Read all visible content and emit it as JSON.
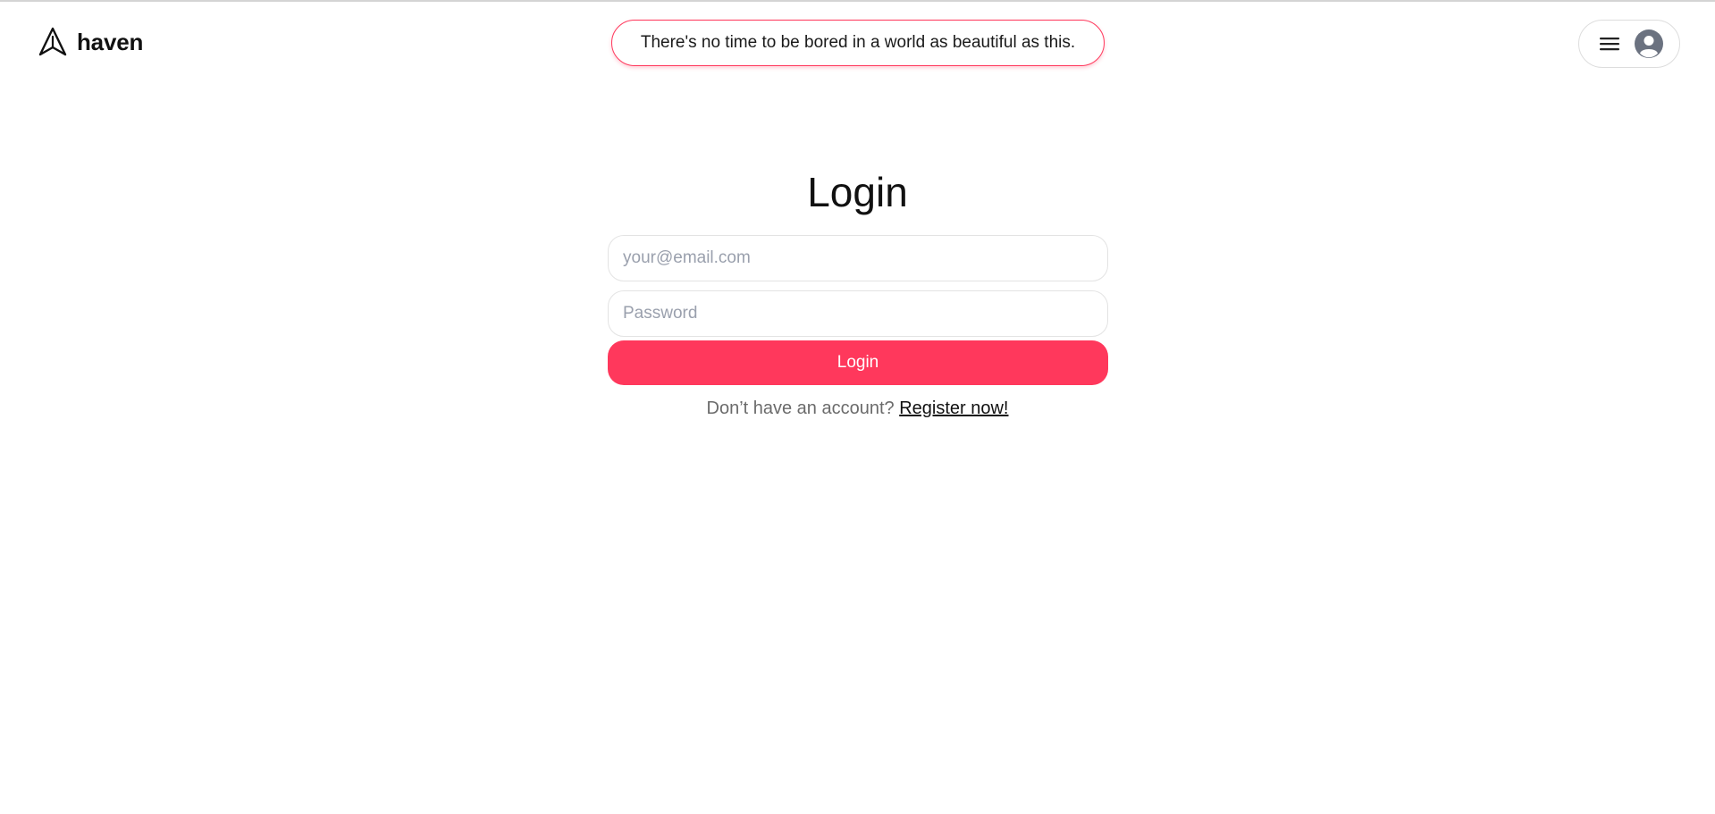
{
  "header": {
    "brand": "haven",
    "quote": "There's no time to be bored in a world as beautiful as this.",
    "menu_icon": "hamburger-menu-icon",
    "avatar_icon": "user-avatar-icon"
  },
  "login": {
    "title": "Login",
    "email_placeholder": "your@email.com",
    "password_placeholder": "Password",
    "button_label": "Login",
    "register_prompt": "Don’t have an account?",
    "register_link": "Register now!"
  },
  "colors": {
    "accent": "#ff385c",
    "text": "#111111",
    "muted": "#6b6b6b",
    "border": "#e3e3e3"
  }
}
